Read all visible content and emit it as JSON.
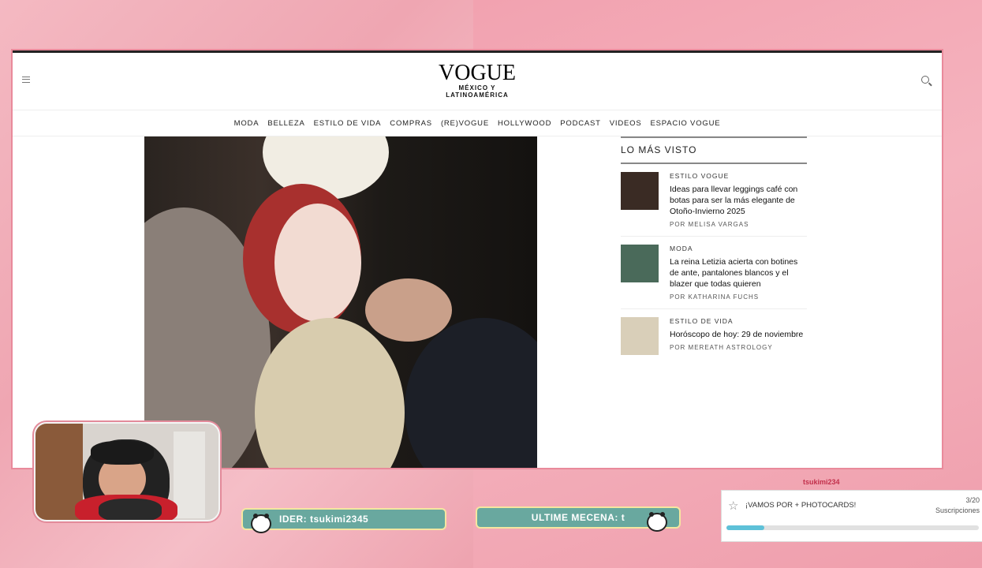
{
  "site": {
    "logo": "VOGUE",
    "logo_sub_1": "MÉXICO Y",
    "logo_sub_2": "LATINOAMÉRICA",
    "nav": [
      "MODA",
      "BELLEZA",
      "ESTILO DE VIDA",
      "COMPRAS",
      "(RE)VOGUE",
      "HOLLYWOOD",
      "PODCAST",
      "VIDEOS",
      "ESPACIO VOGUE"
    ]
  },
  "sidebar": {
    "title": "LO MÁS VISTO",
    "items": [
      {
        "category": "ESTILO VOGUE",
        "title": "Ideas para llevar leggings café con botas para ser la más elegante de Otoño-Invierno 2025",
        "author": "POR MELISA VARGAS",
        "thumb_color": "#3a2b24"
      },
      {
        "category": "MODA",
        "title": "La reina Letizia acierta con botines de ante, pantalones blancos y el blazer que todas quieren",
        "author": "POR KATHARINA FUCHS",
        "thumb_color": "#4a6a5a"
      },
      {
        "category": "ESTILO DE VIDA",
        "title": "Horóscopo de hoy: 29 de noviembre",
        "author": "POR MEREATH ASTROLOGY",
        "thumb_color": "#d9cfb9"
      }
    ]
  },
  "stream": {
    "bar1_text": "IDER: tsukimi2345",
    "bar2_text": "ULTIME MECENA: t",
    "goal_user": "tsukimi234",
    "goal_label": "¡VAMOS POR + PHOTOCARDS!",
    "goal_count": "3/20",
    "goal_type": "Suscripciones",
    "goal_progress": 0.15
  },
  "colors": {
    "background": "#f0a9b4",
    "bar": "#69a89f",
    "goal_fill": "#5ec1d8"
  }
}
